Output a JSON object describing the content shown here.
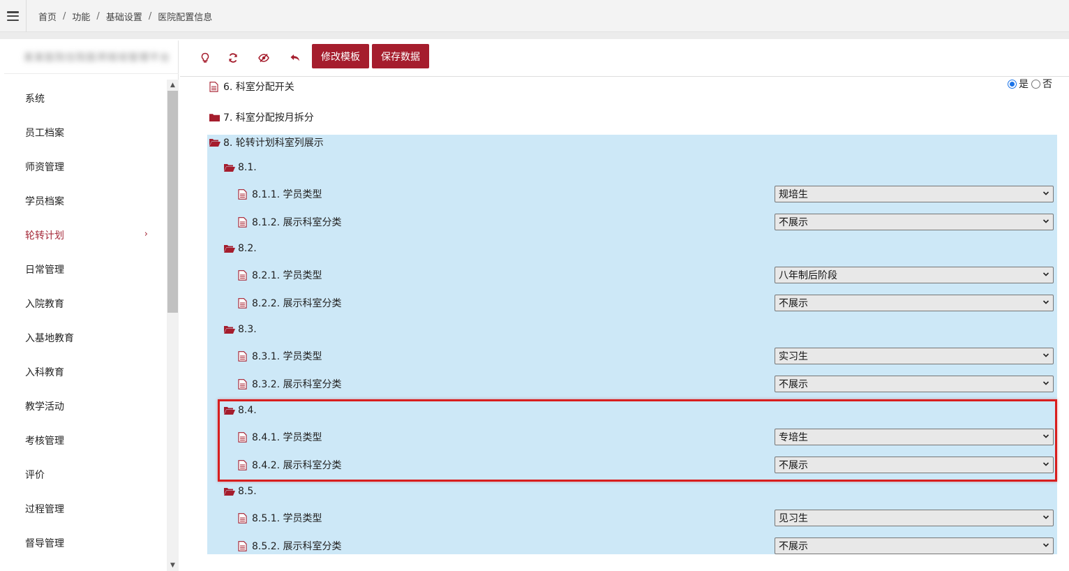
{
  "breadcrumb": {
    "items": [
      "首页",
      "功能",
      "基础设置",
      "医院配置信息"
    ],
    "separator": "/"
  },
  "sidebar": {
    "org_name": "某某医院住院医师规培管理平台",
    "items": [
      {
        "label": "系统"
      },
      {
        "label": "员工档案"
      },
      {
        "label": "师资管理"
      },
      {
        "label": "学员档案"
      },
      {
        "label": "轮转计划",
        "active": true,
        "chevron": "›"
      },
      {
        "label": "日常管理"
      },
      {
        "label": "入院教育"
      },
      {
        "label": "入基地教育"
      },
      {
        "label": "入科教育"
      },
      {
        "label": "教学活动"
      },
      {
        "label": "考核管理"
      },
      {
        "label": "评价"
      },
      {
        "label": "过程管理"
      },
      {
        "label": "督导管理"
      }
    ]
  },
  "toolbar": {
    "icons": [
      "lightbulb-icon",
      "refresh-icon",
      "eye-slash-icon",
      "undo-icon"
    ],
    "edit_template_label": "修改模板",
    "save_data_label": "保存数据"
  },
  "tree": {
    "item6": {
      "label": "6. 科室分配开关",
      "options": [
        "是",
        "否"
      ],
      "selected": "是"
    },
    "item7": {
      "label": "7. 科室分配按月拆分"
    },
    "item8": {
      "label": "8. 轮转计划科室列展示",
      "groups": [
        {
          "label": "8.1.",
          "type_label": "8.1.1. 学员类型",
          "type_value": "规培生",
          "show_label": "8.1.2. 展示科室分类",
          "show_value": "不展示"
        },
        {
          "label": "8.2.",
          "type_label": "8.2.1. 学员类型",
          "type_value": "八年制后阶段",
          "show_label": "8.2.2. 展示科室分类",
          "show_value": "不展示"
        },
        {
          "label": "8.3.",
          "type_label": "8.3.1. 学员类型",
          "type_value": "实习生",
          "show_label": "8.3.2. 展示科室分类",
          "show_value": "不展示"
        },
        {
          "label": "8.4.",
          "type_label": "8.4.1. 学员类型",
          "type_value": "专培生",
          "show_label": "8.4.2. 展示科室分类",
          "show_value": "不展示"
        },
        {
          "label": "8.5.",
          "type_label": "8.5.1. 学员类型",
          "type_value": "见习生",
          "show_label": "8.5.2. 展示科室分类",
          "show_value": "不展示"
        }
      ]
    }
  },
  "colors": {
    "accent": "#a51d2d",
    "group_background": "#cde8f7",
    "highlight_border": "#d81e1e",
    "radio_selected": "#1a73e8"
  }
}
